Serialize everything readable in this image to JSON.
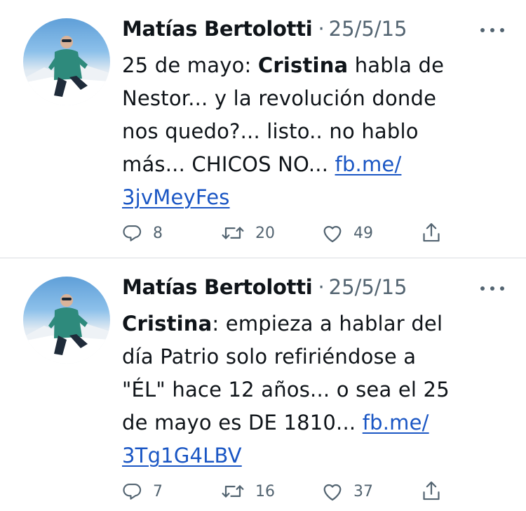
{
  "tweets": [
    {
      "author": "Matías Bertolotti",
      "separator": "·",
      "date": "25/5/15",
      "text_parts": {
        "before_bold": "25 de mayo: ",
        "bold": "Cristina",
        "after_bold": " habla de\nNestor... y la revolución donde\nnos quedo?... listo.. no hablo\nmás... CHICOS NO... ",
        "link": "fb.me/\n3jvMeyFes"
      },
      "stats": {
        "replies": "8",
        "retweets": "20",
        "likes": "49"
      }
    },
    {
      "author": "Matías Bertolotti",
      "separator": "·",
      "date": "25/5/15",
      "text_parts": {
        "before_bold": "",
        "bold": "Cristina",
        "after_bold": ": empieza a hablar del\ndía Patrio solo refiriéndose a\n\"ÉL\" hace 12 años... o sea el 25\nde mayo es DE 1810... ",
        "link": "fb.me/\n3Tg1G4LBV"
      },
      "stats": {
        "replies": "7",
        "retweets": "16",
        "likes": "37"
      }
    }
  ],
  "icons": {
    "reply": "reply-icon",
    "retweet": "retweet-icon",
    "like": "heart-icon",
    "share": "share-icon",
    "more": "more-icon"
  },
  "colors": {
    "text": "#0f1419",
    "muted": "#536471",
    "link": "#1a56c4",
    "divider": "#d9dde1"
  }
}
